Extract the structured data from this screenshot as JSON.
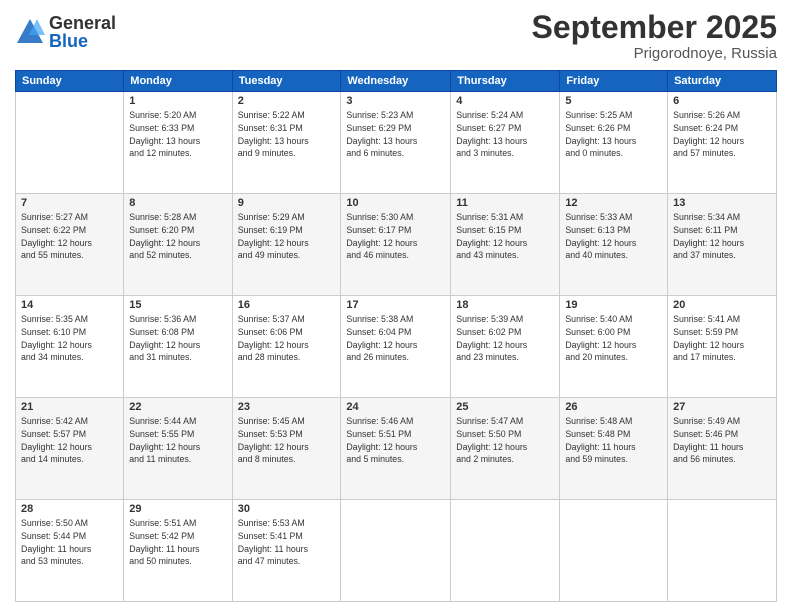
{
  "logo": {
    "general": "General",
    "blue": "Blue"
  },
  "title": "September 2025",
  "location": "Prigorodnoye, Russia",
  "days_header": [
    "Sunday",
    "Monday",
    "Tuesday",
    "Wednesday",
    "Thursday",
    "Friday",
    "Saturday"
  ],
  "weeks": [
    {
      "shaded": false,
      "days": [
        {
          "num": "",
          "info": ""
        },
        {
          "num": "1",
          "info": "Sunrise: 5:20 AM\nSunset: 6:33 PM\nDaylight: 13 hours\nand 12 minutes."
        },
        {
          "num": "2",
          "info": "Sunrise: 5:22 AM\nSunset: 6:31 PM\nDaylight: 13 hours\nand 9 minutes."
        },
        {
          "num": "3",
          "info": "Sunrise: 5:23 AM\nSunset: 6:29 PM\nDaylight: 13 hours\nand 6 minutes."
        },
        {
          "num": "4",
          "info": "Sunrise: 5:24 AM\nSunset: 6:27 PM\nDaylight: 13 hours\nand 3 minutes."
        },
        {
          "num": "5",
          "info": "Sunrise: 5:25 AM\nSunset: 6:26 PM\nDaylight: 13 hours\nand 0 minutes."
        },
        {
          "num": "6",
          "info": "Sunrise: 5:26 AM\nSunset: 6:24 PM\nDaylight: 12 hours\nand 57 minutes."
        }
      ]
    },
    {
      "shaded": true,
      "days": [
        {
          "num": "7",
          "info": "Sunrise: 5:27 AM\nSunset: 6:22 PM\nDaylight: 12 hours\nand 55 minutes."
        },
        {
          "num": "8",
          "info": "Sunrise: 5:28 AM\nSunset: 6:20 PM\nDaylight: 12 hours\nand 52 minutes."
        },
        {
          "num": "9",
          "info": "Sunrise: 5:29 AM\nSunset: 6:19 PM\nDaylight: 12 hours\nand 49 minutes."
        },
        {
          "num": "10",
          "info": "Sunrise: 5:30 AM\nSunset: 6:17 PM\nDaylight: 12 hours\nand 46 minutes."
        },
        {
          "num": "11",
          "info": "Sunrise: 5:31 AM\nSunset: 6:15 PM\nDaylight: 12 hours\nand 43 minutes."
        },
        {
          "num": "12",
          "info": "Sunrise: 5:33 AM\nSunset: 6:13 PM\nDaylight: 12 hours\nand 40 minutes."
        },
        {
          "num": "13",
          "info": "Sunrise: 5:34 AM\nSunset: 6:11 PM\nDaylight: 12 hours\nand 37 minutes."
        }
      ]
    },
    {
      "shaded": false,
      "days": [
        {
          "num": "14",
          "info": "Sunrise: 5:35 AM\nSunset: 6:10 PM\nDaylight: 12 hours\nand 34 minutes."
        },
        {
          "num": "15",
          "info": "Sunrise: 5:36 AM\nSunset: 6:08 PM\nDaylight: 12 hours\nand 31 minutes."
        },
        {
          "num": "16",
          "info": "Sunrise: 5:37 AM\nSunset: 6:06 PM\nDaylight: 12 hours\nand 28 minutes."
        },
        {
          "num": "17",
          "info": "Sunrise: 5:38 AM\nSunset: 6:04 PM\nDaylight: 12 hours\nand 26 minutes."
        },
        {
          "num": "18",
          "info": "Sunrise: 5:39 AM\nSunset: 6:02 PM\nDaylight: 12 hours\nand 23 minutes."
        },
        {
          "num": "19",
          "info": "Sunrise: 5:40 AM\nSunset: 6:00 PM\nDaylight: 12 hours\nand 20 minutes."
        },
        {
          "num": "20",
          "info": "Sunrise: 5:41 AM\nSunset: 5:59 PM\nDaylight: 12 hours\nand 17 minutes."
        }
      ]
    },
    {
      "shaded": true,
      "days": [
        {
          "num": "21",
          "info": "Sunrise: 5:42 AM\nSunset: 5:57 PM\nDaylight: 12 hours\nand 14 minutes."
        },
        {
          "num": "22",
          "info": "Sunrise: 5:44 AM\nSunset: 5:55 PM\nDaylight: 12 hours\nand 11 minutes."
        },
        {
          "num": "23",
          "info": "Sunrise: 5:45 AM\nSunset: 5:53 PM\nDaylight: 12 hours\nand 8 minutes."
        },
        {
          "num": "24",
          "info": "Sunrise: 5:46 AM\nSunset: 5:51 PM\nDaylight: 12 hours\nand 5 minutes."
        },
        {
          "num": "25",
          "info": "Sunrise: 5:47 AM\nSunset: 5:50 PM\nDaylight: 12 hours\nand 2 minutes."
        },
        {
          "num": "26",
          "info": "Sunrise: 5:48 AM\nSunset: 5:48 PM\nDaylight: 11 hours\nand 59 minutes."
        },
        {
          "num": "27",
          "info": "Sunrise: 5:49 AM\nSunset: 5:46 PM\nDaylight: 11 hours\nand 56 minutes."
        }
      ]
    },
    {
      "shaded": false,
      "days": [
        {
          "num": "28",
          "info": "Sunrise: 5:50 AM\nSunset: 5:44 PM\nDaylight: 11 hours\nand 53 minutes."
        },
        {
          "num": "29",
          "info": "Sunrise: 5:51 AM\nSunset: 5:42 PM\nDaylight: 11 hours\nand 50 minutes."
        },
        {
          "num": "30",
          "info": "Sunrise: 5:53 AM\nSunset: 5:41 PM\nDaylight: 11 hours\nand 47 minutes."
        },
        {
          "num": "",
          "info": ""
        },
        {
          "num": "",
          "info": ""
        },
        {
          "num": "",
          "info": ""
        },
        {
          "num": "",
          "info": ""
        }
      ]
    }
  ]
}
